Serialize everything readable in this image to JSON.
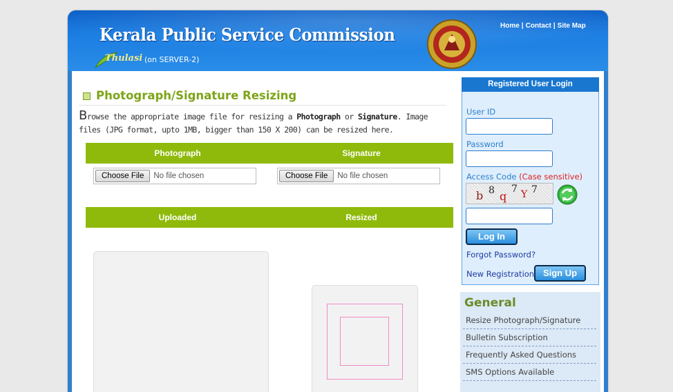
{
  "header": {
    "title": "Kerala Public Service Commission",
    "logo_text": "Thulasi",
    "server": "(on SERVER-2)",
    "links": [
      "Home",
      "Contact",
      "Site Map"
    ]
  },
  "main": {
    "title": "Photograph/Signature Resizing",
    "intro_first_letter": "B",
    "intro_part1": "rowse the appropriate image file for resizing a ",
    "intro_bold1": "Photograph",
    "intro_part2": " or ",
    "intro_bold2": "Signature",
    "intro_part3": ". Image files (JPG format, upto 1MB, bigger than 150 X 200) can be resized here.",
    "upload_headers": [
      "Photograph",
      "Signature"
    ],
    "file_button": "Choose File",
    "file_status": "No file chosen",
    "result_headers": [
      "Uploaded",
      "Resized"
    ]
  },
  "login": {
    "heading": "Registered User Login",
    "userid_label": "User ID",
    "password_label": "Password",
    "access_code_label": "Access Code",
    "access_code_note": "(Case sensitive)",
    "captcha_chars": [
      "b",
      "8",
      "q",
      "7",
      "Y",
      "7"
    ],
    "login_button": "Log In",
    "forgot": "Forgot Password?",
    "new_registration": "New Registration",
    "signup_button": "Sign Up"
  },
  "general": {
    "title": "General",
    "items": [
      "Resize Photograph/Signature",
      "Bulletin Subscription",
      "Frequently Asked Questions",
      "SMS Options Available"
    ]
  },
  "colors": {
    "accent_green": "#8fba0c",
    "title_green": "#7ea418",
    "header_blue": "#1b7ee2",
    "login_blue": "#1a77cf"
  }
}
